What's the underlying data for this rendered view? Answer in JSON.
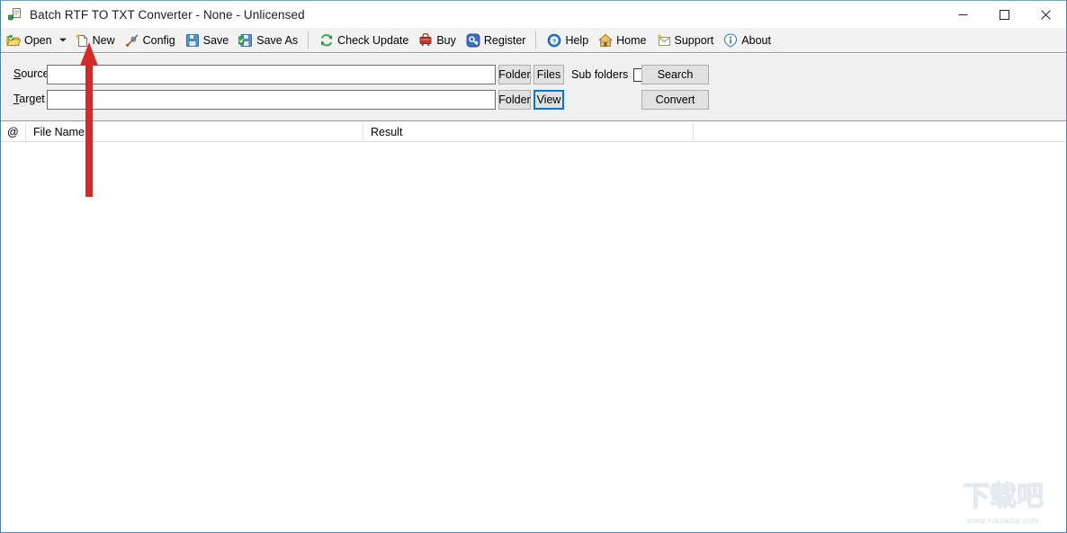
{
  "window": {
    "title": "Batch RTF TO TXT Converter - None - Unlicensed",
    "app_icon": "converter-icon",
    "border_color": "#4a87b5",
    "controls": {
      "minimize": "minimize-icon",
      "maximize": "maximize-icon",
      "close": "close-icon"
    }
  },
  "toolbar": {
    "items": [
      {
        "label": "Open",
        "icon": "open-folder-icon",
        "has_dropdown": true
      },
      {
        "label": "New",
        "icon": "new-document-icon",
        "has_dropdown": false
      },
      {
        "label": "Config",
        "icon": "tools-icon",
        "has_dropdown": false
      },
      {
        "label": "Save",
        "icon": "floppy-disk-icon",
        "has_dropdown": false
      },
      {
        "label": "Save As",
        "icon": "floppy-disk-as-icon",
        "has_dropdown": false
      },
      {
        "label": "Check Update",
        "icon": "refresh-icon",
        "has_dropdown": false
      },
      {
        "label": "Buy",
        "icon": "shopping-cart-icon",
        "has_dropdown": false
      },
      {
        "label": "Register",
        "icon": "register-key-icon",
        "has_dropdown": false
      },
      {
        "label": "Help",
        "icon": "question-mark-icon",
        "has_dropdown": false
      },
      {
        "label": "Home",
        "icon": "house-icon",
        "has_dropdown": false
      },
      {
        "label": "Support",
        "icon": "envelope-icon",
        "has_dropdown": false
      },
      {
        "label": "About",
        "icon": "info-icon",
        "has_dropdown": false
      }
    ],
    "separator_after": [
      4,
      7
    ]
  },
  "form": {
    "source": {
      "label": "Source",
      "accel": "S",
      "rest": "ource",
      "value": "",
      "placeholder": "",
      "folder_button": "Folder",
      "files_button": "Files",
      "subfolders_label": "Sub folders",
      "subfolders_checked": false,
      "action_button": "Search"
    },
    "target": {
      "label": "Target",
      "accel": "T",
      "rest": "arget",
      "value": "",
      "placeholder": "",
      "folder_button": "Folder",
      "view_button": "View",
      "view_focused": true,
      "action_button": "Convert"
    }
  },
  "list": {
    "columns": [
      {
        "key": "at",
        "label": "@"
      },
      {
        "key": "name",
        "label": "File Name"
      },
      {
        "key": "result",
        "label": "Result"
      },
      {
        "key": "blank",
        "label": ""
      }
    ],
    "rows": []
  },
  "annotation": {
    "arrow": {
      "color": "#d32b2b",
      "points_to": "New",
      "direction": "up"
    }
  },
  "watermark": {
    "text_cn": "下载吧",
    "url": "www.xiazaiba.com",
    "color": "#b9cad9"
  }
}
